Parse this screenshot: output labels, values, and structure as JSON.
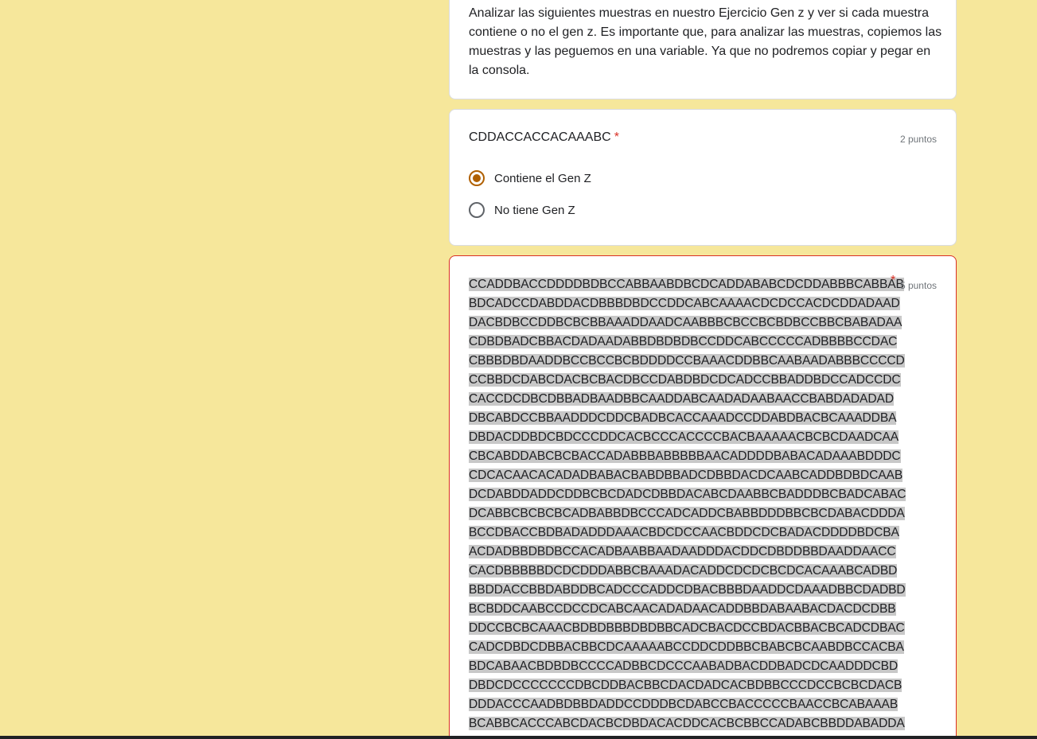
{
  "description": {
    "text": "Analizar las siguientes muestras en nuestro Ejercicio Gen z y ver si cada muestra contiene o no el gen z. Es importante que, para analizar las muestras, copiemos las muestras y las peguemos en una variable. Ya que no podremos copiar y pegar en la consola."
  },
  "question1": {
    "title": "CDDACCACCACAAABC",
    "required_mark": "*",
    "points": "2 puntos",
    "options": [
      {
        "label": "Contiene el Gen Z",
        "selected": true
      },
      {
        "label": "No tiene Gen Z",
        "selected": false
      }
    ],
    "accent_color": "#b06000"
  },
  "question2": {
    "required_mark": "*",
    "points": "5 puntos",
    "border_color": "#d93025",
    "sequence_lines": [
      "CCADDBACCDDDDBDBCCABBAABDBCDCADDABABCDCDDABBBCABBAB",
      "BDCADCCDABDDACDBBBDBDCCDDCABCAAAACDCDCCACDCDDADAAD",
      "DACBDBCCDDBCBCBBAAADDAADCAABBBCBCCBCBDBCCBBCBABADAA",
      "CDBDBADCBBACDADAADABBDBDBDBCCDDCABCCCCCADBBBBCCDAC",
      "CBBBDBDAADDBCCBCCBCBDDDDCCBAAACDDBBCAABAADABBBCCCCD",
      "CCBBDCDABCDACBCBACDBCCDABDBDCDCADCCBBADDBDCCADCCDC",
      "CACCDCDBCDBBADBAADBBCAADDABCAADADAABAACCBABDADADAD",
      "DBCABDCCBBAADDDCDDCBADBCACCAAADCCDDABDBACBCAAADDBA",
      "DBDACDDBDCBDCCCDDCACBCCCACCCCBACBAAAAACBCBCDAADCAA",
      "CBCABDDABCBCBACCADABBBABBBBBAACADDDDBABACADAAABDDDC",
      "CDCACAACACADADBABACBABDBBADCDBBDACDCAABCADDBDBDCAAB",
      "DCDABDDADDCDDBCBCDADCDBBDACABCDAABBCBADDDBCBADCABAC",
      "DCABBCBCBCBCADBABBDBCCCADCADDCBABBDDDBBCBCDABACDDDA",
      "BCCDBACCBDBADADDDAAACBDCDCCAACBDDCDCBADACDDDDBDCBA",
      "ACDADBBDBDBCCACADBAABBAADAADDDACDDCDBDDBBDAADDAACC",
      "CACDBBBBBDCDCDDDABBCBAAADACADDCDCDCBCDCACAAABCADBD",
      "BBDDACCBBDABDDBCADCCCADDCDBACBBBDAADDCDAAADBBCDADBD",
      "BCBDDCAABCCDCCDCABCAACADADAACADDBBDABAABACDACDCDBB",
      "DDCCBCBCAAACBDBDBBBDBDBBCADCBACDCCBDACBBACBCADCDBAC",
      "CADCDBDCDBBACBBCDCAAAAABCCDDCDDBBCBABCBCAABDBCCACBA",
      "BDCABAACBDBDBCCCCADBBCDCCCAABADBACDDBADCDCAADDDCBD",
      "DBDCDCCCCCCCDBCDDBACBBCDACDADCACBDBBCCCDCCBCBCDACB",
      "DDDACCCAADBDBBDADDCCDDDBCDABCCBACCCCCBAACCBCABAAAB",
      "BCABBCACCCABCDACBCDBDACACDDCACBCBBCCADABCBBDDABADDA"
    ]
  }
}
